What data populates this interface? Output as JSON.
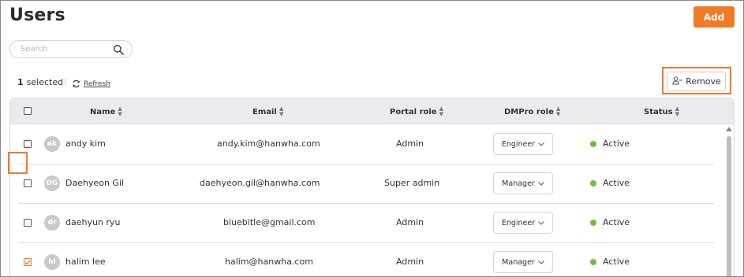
{
  "header": {
    "title": "Users",
    "add_label": "Add"
  },
  "search": {
    "placeholder": "Search",
    "value": ""
  },
  "selection": {
    "count": "1",
    "label": "selected",
    "refresh_label": "Refresh"
  },
  "toolbar": {
    "remove_label": "Remove"
  },
  "table": {
    "columns": {
      "name": "Name",
      "email": "Email",
      "portal_role": "Portal role",
      "dmpro_role": "DMPro role",
      "status": "Status"
    },
    "rows": [
      {
        "initials": "ak",
        "name": "andy kim",
        "email": "andy.kim@hanwha.com",
        "portal_role": "Admin",
        "dmpro_role": "Engineer",
        "status": "Active",
        "checked": false
      },
      {
        "initials": "DG",
        "name": "Daehyeon Gil",
        "email": "daehyeon.gil@hanwha.com",
        "portal_role": "Super admin",
        "dmpro_role": "Manager",
        "status": "Active",
        "checked": false
      },
      {
        "initials": "dr",
        "name": "daehyun ryu",
        "email": "bluebitle@gmail.com",
        "portal_role": "Admin",
        "dmpro_role": "Engineer",
        "status": "Active",
        "checked": false
      },
      {
        "initials": "hl",
        "name": "halim lee",
        "email": "halim@hanwha.com",
        "portal_role": "Admin",
        "dmpro_role": "Manager",
        "status": "Active",
        "checked": true
      }
    ]
  },
  "colors": {
    "accent": "#f07a25",
    "active": "#6cc13a",
    "header_bg": "#e9ebee"
  }
}
